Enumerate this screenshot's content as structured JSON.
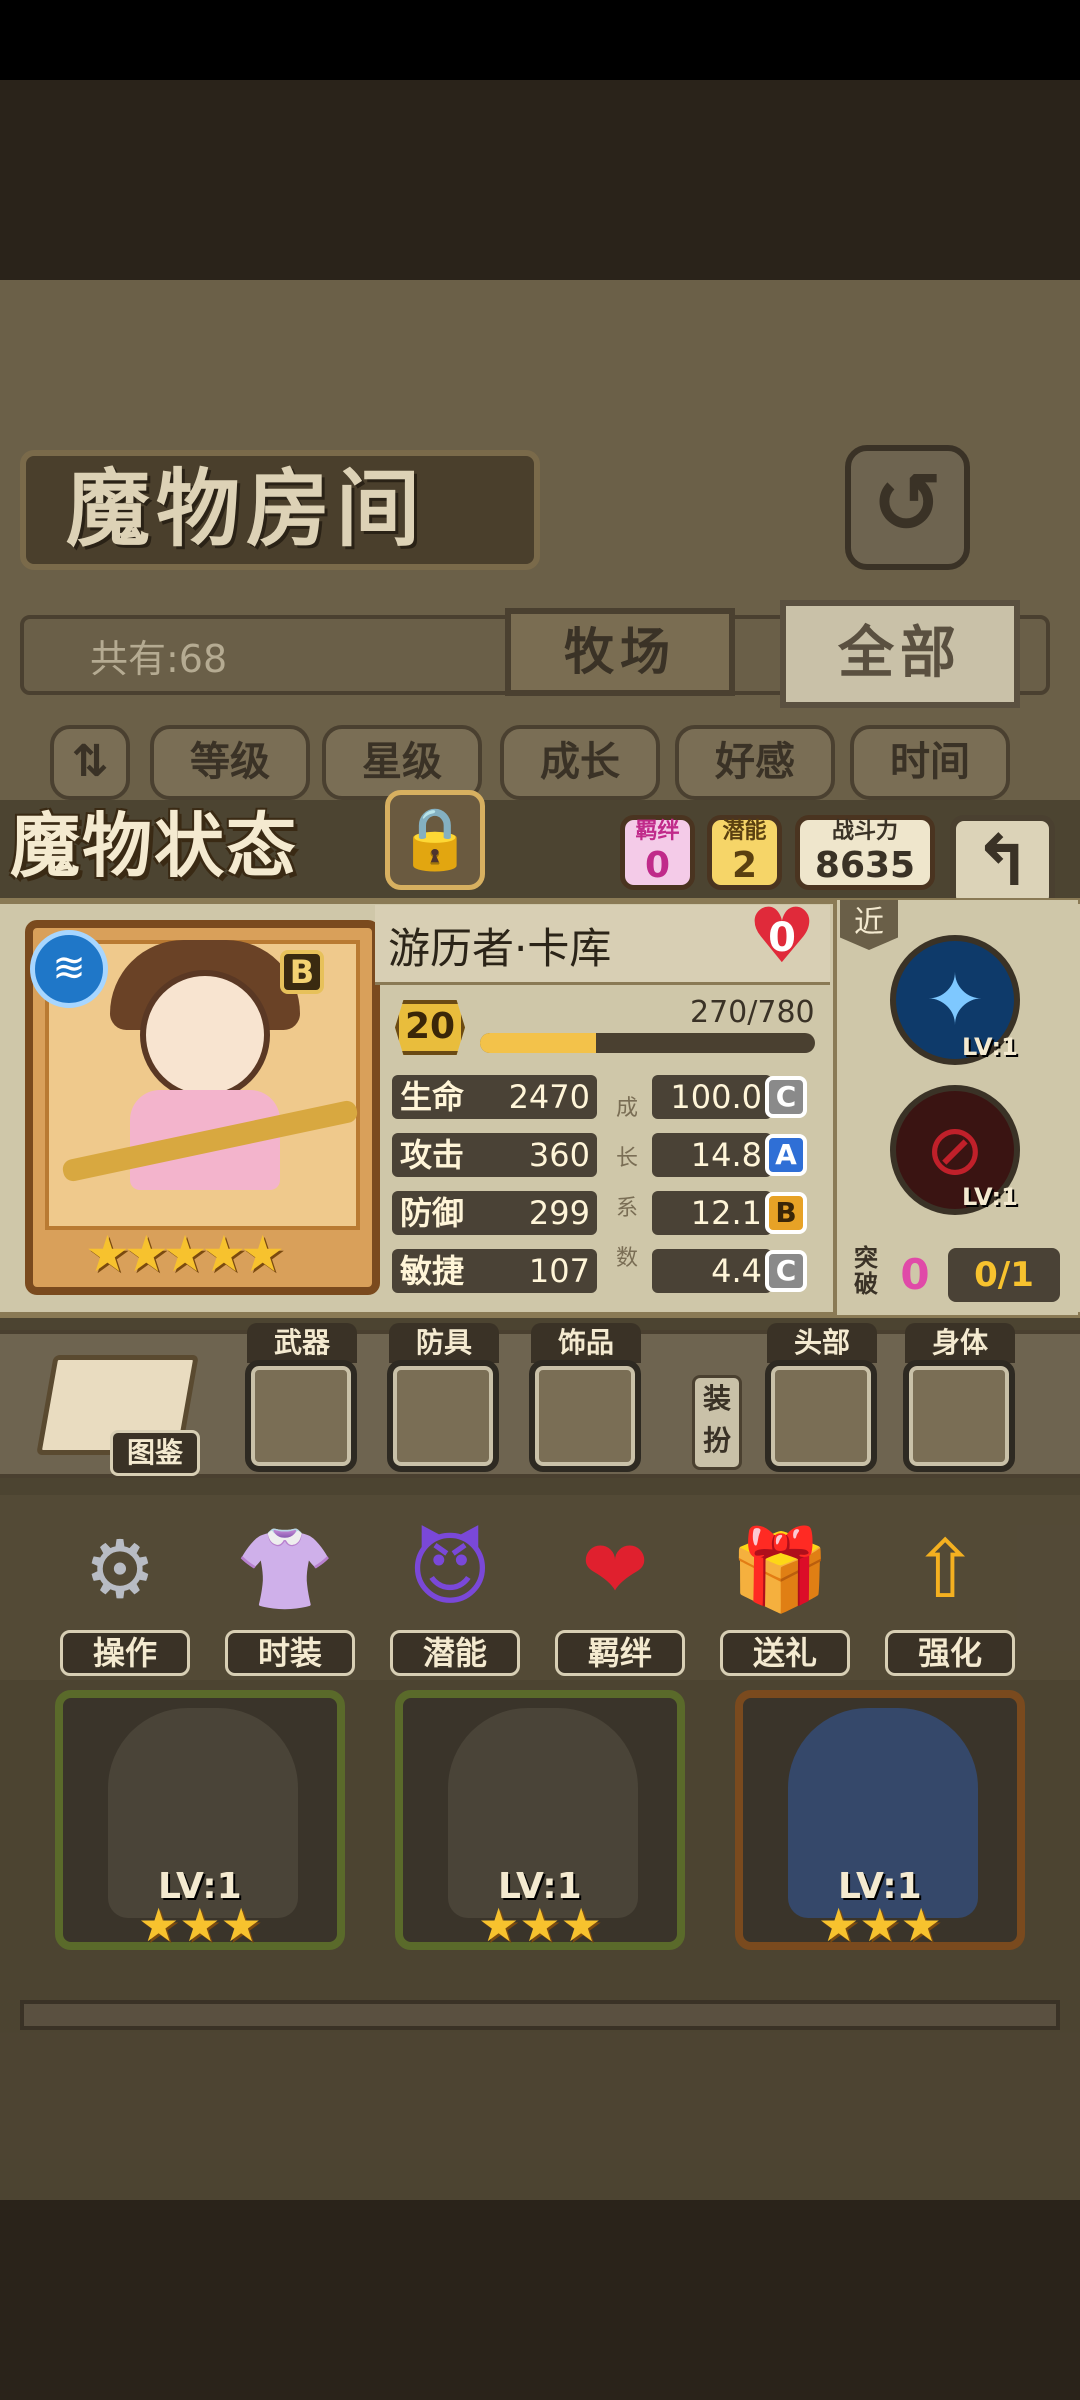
{
  "room": {
    "title": "魔物房间",
    "back_icon": "back-arrow-icon",
    "count": "共有:68",
    "tabs": [
      "牧场",
      "全部"
    ]
  },
  "sort_buttons": [
    "等级",
    "星级",
    "成长",
    "好感",
    "时间"
  ],
  "status": {
    "title": "魔物状态",
    "bond_label": "羁绊",
    "bond_value": "0",
    "potential_label": "潜能",
    "potential_value": "2",
    "power_label": "战斗力",
    "power_value": "8635"
  },
  "monster": {
    "name": "游历者·卡库",
    "grade": "B",
    "element_icon": "water-wave-icon",
    "affection": "0",
    "stars": "★★★★★",
    "star_count": 5,
    "level": "20",
    "exp_text": "270/780",
    "exp_fraction": 0.346,
    "stats": [
      {
        "label": "生命",
        "value": "2470",
        "growth": "100.0",
        "grade": "C"
      },
      {
        "label": "攻击",
        "value": "360",
        "growth": "14.8",
        "grade": "A"
      },
      {
        "label": "防御",
        "value": "299",
        "growth": "12.1",
        "grade": "B"
      },
      {
        "label": "敏捷",
        "value": "107",
        "growth": "4.4",
        "grade": "C"
      }
    ],
    "growth_caption": [
      "成",
      "长",
      "系",
      "数"
    ],
    "range_tag": "近",
    "skills": [
      {
        "icon": "ice-crystal-icon",
        "level": "LV:1"
      },
      {
        "icon": "sealed-skill-icon",
        "level": "LV:1"
      }
    ],
    "breakthrough_label": "突破",
    "breakthrough_value": "0",
    "breakthrough_progress": "0/1"
  },
  "equipment": {
    "dex_label": "图鉴",
    "slots": [
      "武器",
      "防具",
      "饰品",
      "头部",
      "身体"
    ],
    "equip_btn": "装扮"
  },
  "actions": [
    {
      "label": "操作",
      "icon": "gear-icon"
    },
    {
      "label": "时装",
      "icon": "outfit-icon"
    },
    {
      "label": "潜能",
      "icon": "demon-icon"
    },
    {
      "label": "羁绊",
      "icon": "hearts-icon"
    },
    {
      "label": "送礼",
      "icon": "gift-icon"
    },
    {
      "label": "强化",
      "icon": "upgrade-arrows-icon"
    }
  ],
  "cards": [
    {
      "level": "LV:1",
      "stars": "★★★"
    },
    {
      "level": "LV:1",
      "stars": "★★★"
    },
    {
      "level": "LV:1",
      "stars": "★★★"
    }
  ],
  "colors": {
    "accent_gold": "#f7c22e",
    "grade_A": "#2f6fd6",
    "grade_B": "#e7a226",
    "grade_C": "#8a8a8a"
  }
}
